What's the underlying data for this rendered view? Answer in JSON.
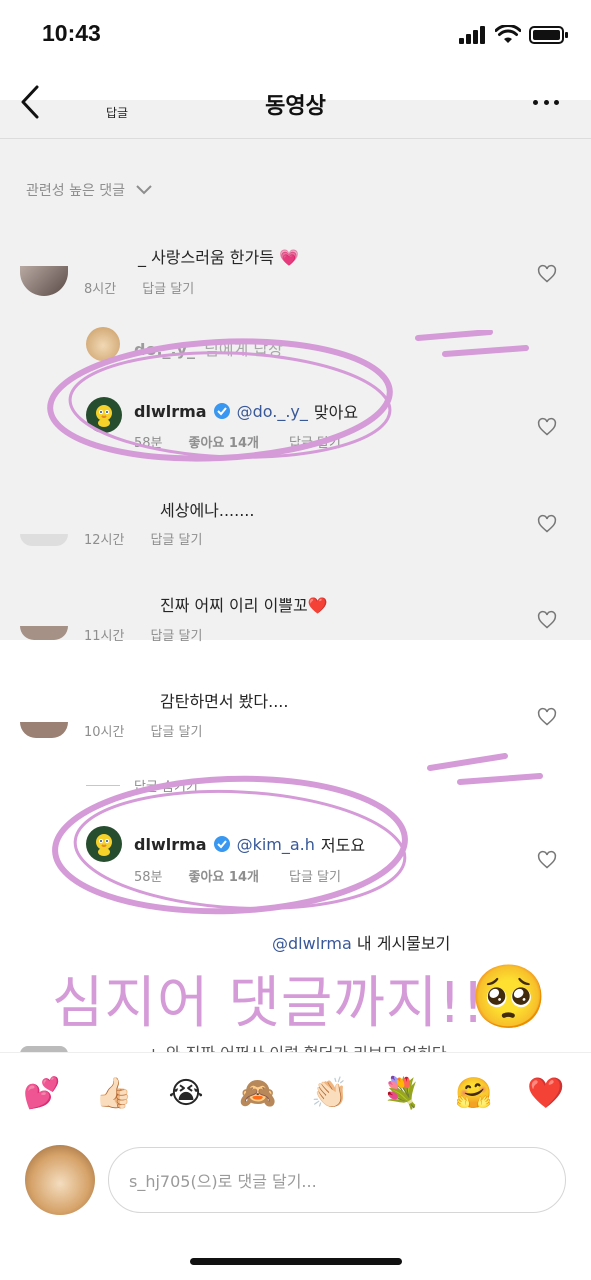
{
  "status": {
    "time": "10:43"
  },
  "header": {
    "title": "동영상",
    "small_label": "답글"
  },
  "sort": {
    "label": "관련성 높은 댓글"
  },
  "comments": [
    {
      "text": "_ 사랑스러움 한가득 💗",
      "time": "8시간",
      "reply": "답글 달기"
    },
    {
      "text": "세상에나.......",
      "time": "12시간",
      "reply": "답글 달기"
    },
    {
      "text": "진짜 어찌 이리 이쁠꼬❤️",
      "time": "11시간",
      "reply": "답글 달기"
    },
    {
      "text": "감탄하면서 봤다....",
      "time": "10시간",
      "reply": "답글 달기"
    }
  ],
  "replying_to": {
    "prefix": "do._.y_",
    "suffix": "님에게 답장"
  },
  "replies": [
    {
      "user": "dlwlrma",
      "mention": "@do._.y_",
      "text": "맞아요",
      "time": "58분",
      "likes": "좋아요 14개",
      "reply": "답글 달기"
    },
    {
      "user": "dlwlrma",
      "mention": "@kim_a.h",
      "text": "저도요",
      "time": "58분",
      "likes": "좋아요 14개",
      "reply": "답글 달기"
    }
  ],
  "hide_replies": "답글 숨기기",
  "partial_line": {
    "mention": "@dlwlrma",
    "text": "내 게시물보기"
  },
  "partial_line2": "ㅅ 와 진짜 어쩌사 이렇 헐더가 리브모 없히다",
  "overlay": {
    "text": "심지어 댓글까지!!"
  },
  "reactions": [
    "💕",
    "👍🏻",
    "😭",
    "🙈",
    "👏🏻",
    "💐",
    "🤗",
    "❤️"
  ],
  "composer": {
    "placeholder": "s_hj705(으)로 댓글 달기..."
  },
  "colors": {
    "mention": "#385898",
    "highlight": "#d59ad8",
    "muted": "#8e8e8e"
  }
}
